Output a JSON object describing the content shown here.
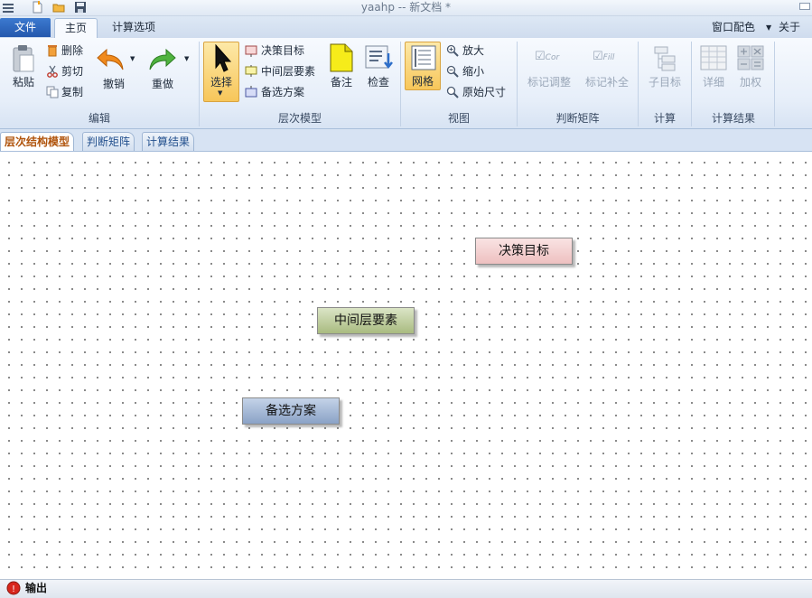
{
  "window": {
    "title": "yaahp -- 新文档 *"
  },
  "menu": {
    "file": "文件",
    "home": "主页",
    "calc_options": "计算选项",
    "window_color": "窗口配色",
    "about": "关于"
  },
  "ribbon": {
    "edit": {
      "label": "编辑",
      "paste": "粘贴",
      "delete": "删除",
      "cut": "剪切",
      "copy": "复制",
      "undo": "撤销",
      "redo": "重做"
    },
    "hierarchy": {
      "label": "层次模型",
      "select": "选择",
      "goal": "决策目标",
      "middle": "中间层要素",
      "alternative": "备选方案",
      "note": "备注",
      "check": "检查"
    },
    "view": {
      "label": "视图",
      "grid": "网格",
      "zoom_in": "放大",
      "zoom_out": "缩小",
      "original": "原始尺寸"
    },
    "matrix": {
      "label": "判断矩阵",
      "mark_adjust": "标记调整",
      "mark_fill": "标记补全",
      "cor_icon_text": "Cor",
      "fill_icon_text": "Fill"
    },
    "calc": {
      "label": "计算",
      "sub_goal": "子目标"
    },
    "result": {
      "label": "计算结果",
      "detail": "详细",
      "weight": "加权"
    }
  },
  "doc_tabs": [
    "层次结构模型",
    "判断矩阵",
    "计算结果"
  ],
  "canvas": {
    "nodes": {
      "goal": "决策目标",
      "middle": "中间层要素",
      "alternative": "备选方案"
    }
  },
  "status": {
    "output": "输出"
  },
  "colors": {
    "goal_node": "#f0c4c4",
    "middle_node": "#aebf88",
    "alternative_node": "#8fa6c8",
    "file_tab": "#2f68c0",
    "select_highlight": "#f7c65a"
  }
}
